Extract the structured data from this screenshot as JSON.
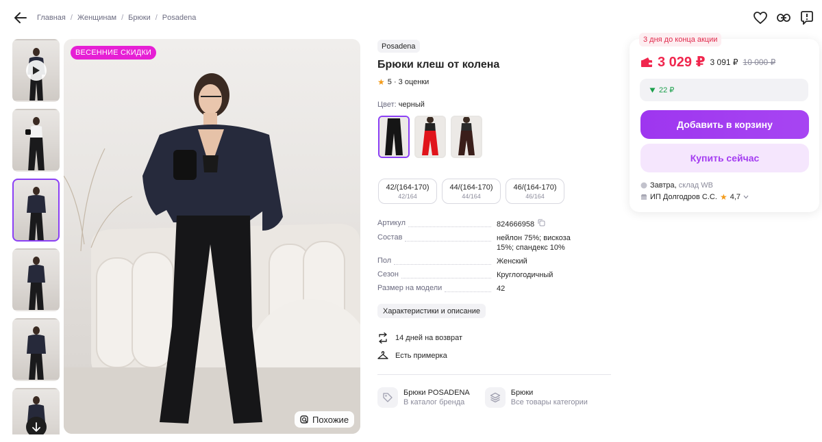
{
  "header": {
    "breadcrumbs": [
      "Главная",
      "Женщинам",
      "Брюки",
      "Posadena"
    ]
  },
  "gallery": {
    "thumbnails_count": 6,
    "active_thumb": 3,
    "promo_badge": "ВЕСЕННИЕ СКИДКИ",
    "similar_label": "Похожие"
  },
  "product": {
    "brand": "Posadena",
    "title": "Брюки клеш от колена",
    "rating": "5",
    "rating_sep": " · ",
    "reviews": "3 оценки",
    "color_label": "Цвет:",
    "color_value": "черный",
    "sizes": [
      {
        "main": "42/(164-170)",
        "sub": "42/164"
      },
      {
        "main": "44/(164-170)",
        "sub": "44/164"
      },
      {
        "main": "46/(164-170)",
        "sub": "46/164"
      }
    ],
    "specs": [
      {
        "key": "Артикул",
        "value": "824666958"
      },
      {
        "key": "Состав",
        "value": "нейлон 75%; вискоза 15%; спандекс 10%"
      },
      {
        "key": "Пол",
        "value": "Женский"
      },
      {
        "key": "Сезон",
        "value": "Круглогодичный"
      },
      {
        "key": "Размер на модели",
        "value": "42"
      }
    ],
    "description_button": "Характеристики и описание",
    "return_text": "14 дней на возврат",
    "fitting_text": "Есть примерка",
    "brand_link_title": "Брюки POSADENA",
    "brand_link_sub": "В каталог бренда",
    "category_link_title": "Брюки",
    "category_link_sub": "Все товары категории"
  },
  "buy_card": {
    "promo_timer": "3 дня до конца акции",
    "price": "3 029 ₽",
    "price_wallet": "3 091 ₽",
    "price_old": "10 000 ₽",
    "cashback": "22 ₽",
    "add_to_cart": "Добавить в корзину",
    "buy_now": "Купить сейчас",
    "delivery_day": "Завтра",
    "delivery_sep": ", ",
    "delivery_place": "склад WB",
    "seller_name": "ИП Долгодров С.С.",
    "seller_rating": "4,7"
  },
  "colors": {
    "accent": "#a03cf0",
    "price": "#f0264d",
    "promo": "#e61fd5",
    "cashback": "#1a9f4a"
  }
}
